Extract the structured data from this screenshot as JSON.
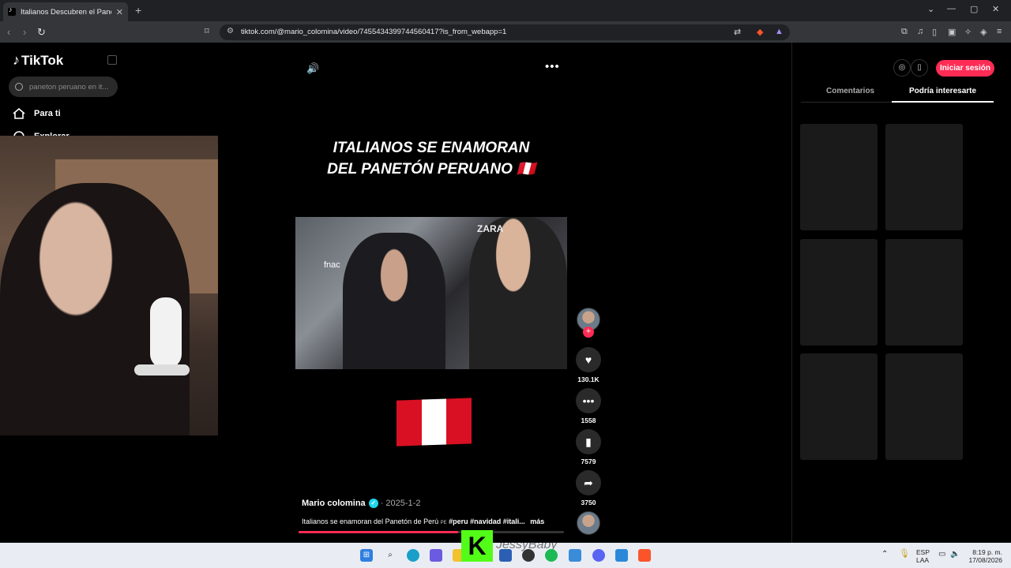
{
  "browser": {
    "tab_title": "Italianos Descubren el Panetó",
    "tab_close": "✕",
    "new_tab": "+",
    "url": "tiktok.com/@mario_colomina/video/7455434399744560417?is_from_webapp=1",
    "window_controls": [
      "⌄",
      "—",
      "▢",
      "✕"
    ]
  },
  "sidebar": {
    "logo": "TikTok",
    "search_placeholder": "paneton peruano en it...",
    "nav": [
      {
        "label": "Para ti"
      },
      {
        "label": "Explorar"
      }
    ]
  },
  "video": {
    "headline_line1": "ITALIANOS SE ENAMORAN",
    "headline_line2": "DEL PANETÓN PERUANO 🇵🇪",
    "frame_store_text": "ZARA",
    "frame_fnac_text": "fnac",
    "volume_icon": "🔊",
    "more_icon": "•••"
  },
  "actions": {
    "likes": "130.1K",
    "comments": "1558",
    "saves": "7579",
    "shares": "3750"
  },
  "post": {
    "author": "Mario colomina",
    "date": "· 2025-1-2",
    "caption_text": "Italianos se enamoran del Panetón de Perú",
    "caption_flag": "PE",
    "caption_tags": "#peru #navidad #itali...",
    "more": "más",
    "progress": 0.6
  },
  "right_panel": {
    "login": "Iniciar sesión",
    "tabs": [
      "Comentarios",
      "Podría interesarte"
    ],
    "active_tab": 1
  },
  "taskbar": {
    "kick_logo": "K",
    "streamer_name": "JessyBaby",
    "lang": "ESP",
    "lang2": "LAA",
    "time": "8:19 p. m.",
    "date": "17/08/2026"
  },
  "colors": {
    "accent": "#fe2c55",
    "verified": "#20d5ec",
    "flag_red": "#d91023",
    "kick_green": "#53fc18"
  }
}
